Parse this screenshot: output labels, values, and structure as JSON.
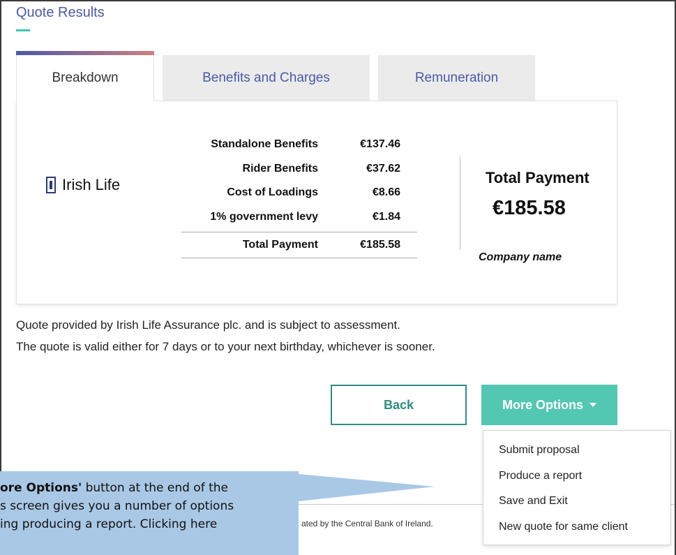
{
  "header": {
    "title": "Quote Results"
  },
  "tabs": [
    {
      "label": "Breakdown",
      "active": true
    },
    {
      "label": "Benefits and Charges",
      "active": false
    },
    {
      "label": "Remuneration",
      "active": false
    }
  ],
  "provider": {
    "logo_text": "Irish Life",
    "logo_icon": "irish-life-logo-icon"
  },
  "breakdown": [
    {
      "label": "Standalone Benefits",
      "value": "€137.46"
    },
    {
      "label": "Rider Benefits",
      "value": "€37.62"
    },
    {
      "label": "Cost of Loadings",
      "value": "€8.66"
    },
    {
      "label": "1% government levy",
      "value": "€1.84"
    }
  ],
  "breakdown_total": {
    "label": "Total Payment",
    "value": "€185.58"
  },
  "summary": {
    "label": "Total Payment",
    "amount": "€185.58",
    "company_label": "Company name"
  },
  "notes": [
    "Quote provided by Irish Life Assurance plc. and is subject to assessment.",
    "The quote is valid either for 7 days or to your next birthday, whichever is sooner."
  ],
  "actions": {
    "back_label": "Back",
    "more_label": "More Options"
  },
  "more_menu": [
    "Submit proposal",
    "Produce a report",
    "Save and Exit",
    "New quote for same client"
  ],
  "footer": {
    "regulated_text": "ated by the Central Bank of Ireland."
  },
  "callout": {
    "bold": "ore Options'",
    "line1_rest": " button at the end of the",
    "line2": "s screen gives you a number of options",
    "line3": "ing producing a report.  Clicking here"
  },
  "colors": {
    "accent": "#52c7b2",
    "brand": "#4a5aa8",
    "callout": "#a9c8e6"
  }
}
